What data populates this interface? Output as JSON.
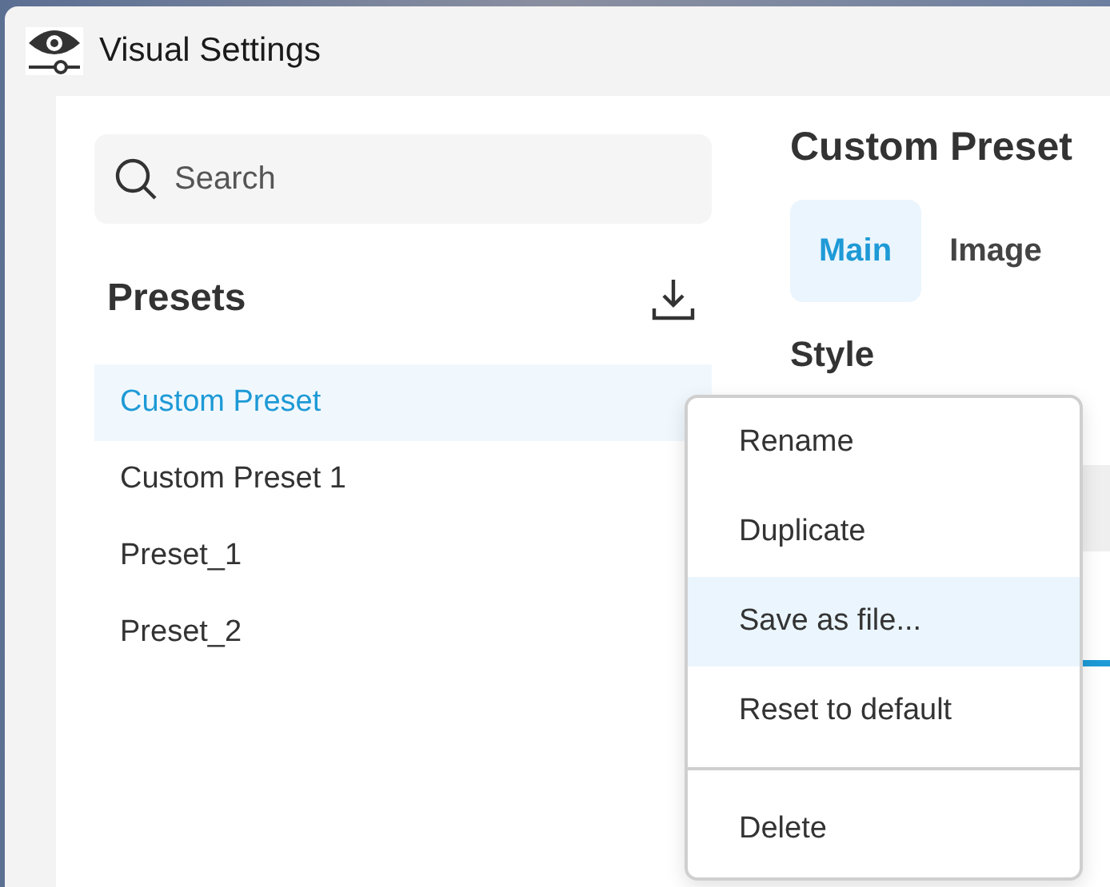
{
  "window": {
    "title": "Visual Settings"
  },
  "sidebar": {
    "search": {
      "placeholder": "Search"
    },
    "heading": "Presets",
    "presets": [
      {
        "label": "Custom Preset",
        "selected": true
      },
      {
        "label": "Custom Preset 1",
        "selected": false
      },
      {
        "label": "Preset_1",
        "selected": false
      },
      {
        "label": "Preset_2",
        "selected": false
      }
    ]
  },
  "main": {
    "title": "Custom Preset",
    "tabs": [
      {
        "label": "Main",
        "selected": true
      },
      {
        "label": "Image",
        "selected": false
      }
    ],
    "section": "Style"
  },
  "context_menu": {
    "items": [
      {
        "kind": "item",
        "label": "Rename",
        "selected": false
      },
      {
        "kind": "item",
        "label": "Duplicate",
        "selected": false
      },
      {
        "kind": "item",
        "label": "Save as file...",
        "selected": true
      },
      {
        "kind": "item",
        "label": "Reset to default",
        "selected": false
      },
      {
        "kind": "separator"
      },
      {
        "kind": "item",
        "label": "Delete",
        "selected": false
      }
    ]
  }
}
